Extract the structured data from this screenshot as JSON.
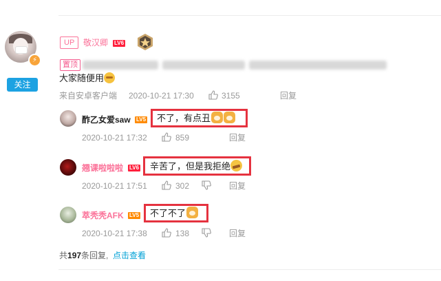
{
  "main_comment": {
    "up_tag": "UP",
    "username": "敬汉卿",
    "level": "LV6",
    "pin_tag": "置顶",
    "text": "大家随便用",
    "client": "来自安卓客户端",
    "time": "2020-10-21 17:30",
    "likes": "3155",
    "reply_label": "回复",
    "follow_label": "关注"
  },
  "replies": [
    {
      "username": "酢乙女爱saw",
      "level": "LV5",
      "text": "不了，有点丑",
      "time": "2020-10-21 17:32",
      "likes": "859",
      "reply_label": "回复"
    },
    {
      "username": "翘课啦啦啦",
      "level": "LV6",
      "text": "辛苦了，但是我拒绝",
      "time": "2020-10-21 17:51",
      "likes": "302",
      "reply_label": "回复"
    },
    {
      "username": "萃秃秃AFK",
      "level": "LV5",
      "text": "不了不了",
      "time": "2020-10-21 17:38",
      "likes": "138",
      "reply_label": "回复"
    }
  ],
  "footer": {
    "prefix": "共",
    "count": "197",
    "suffix": "条回复,",
    "view_label": "点击查看"
  },
  "colors": {
    "pink_name": "#fb7299",
    "link_blue": "#00a1d6",
    "follow_blue": "#1da2e2",
    "highlight_red": "#e5323f"
  }
}
